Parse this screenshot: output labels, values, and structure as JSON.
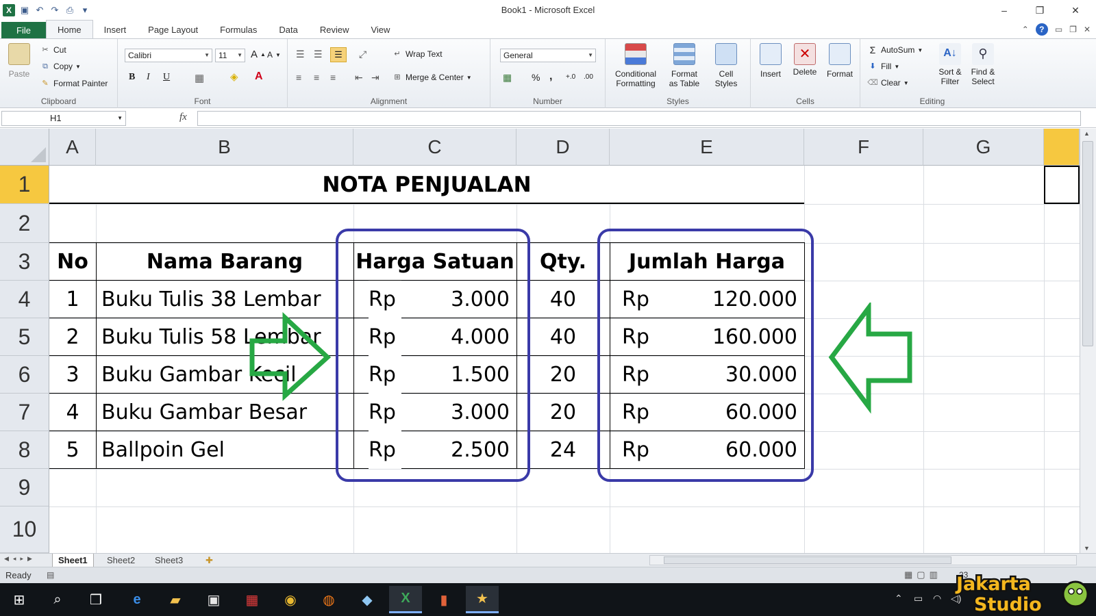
{
  "window": {
    "title": "Book1 - Microsoft Excel",
    "minimize": "–",
    "restore": "❐",
    "close": "✕"
  },
  "quick_access": {
    "app_icon": "X",
    "save": "▣",
    "undo": "↶",
    "redo": "↷",
    "preview": "⎙",
    "customize": "▾"
  },
  "tabs": [
    "File",
    "Home",
    "Insert",
    "Page Layout",
    "Formulas",
    "Data",
    "Review",
    "View"
  ],
  "ribbon": {
    "clipboard": {
      "label": "Clipboard",
      "paste": "Paste",
      "cut": "Cut",
      "copy": "Copy",
      "format_painter": "Format Painter"
    },
    "font": {
      "label": "Font",
      "name": "Calibri",
      "size": "11",
      "grow": "A",
      "shrink": "A",
      "bold": "B",
      "italic": "I",
      "underline": "U"
    },
    "alignment": {
      "label": "Alignment",
      "wrap_text": "Wrap Text",
      "merge_center": "Merge & Center"
    },
    "number": {
      "label": "Number",
      "format": "General",
      "percent": "%",
      "comma": ",",
      "inc_decimal": "+.0",
      "dec_decimal": ".00"
    },
    "styles": {
      "label": "Styles",
      "conditional_formatting_1": "Conditional",
      "conditional_formatting_2": "Formatting",
      "format_table_1": "Format",
      "format_table_2": "as Table",
      "cell_styles_1": "Cell",
      "cell_styles_2": "Styles"
    },
    "cells": {
      "label": "Cells",
      "insert": "Insert",
      "delete": "Delete",
      "format": "Format"
    },
    "editing": {
      "label": "Editing",
      "autosum": "AutoSum",
      "fill": "Fill",
      "clear": "Clear",
      "sort_filter_1": "Sort &",
      "sort_filter_2": "Filter",
      "find_select_1": "Find &",
      "find_select_2": "Select"
    }
  },
  "formula_bar": {
    "name_box": "H1",
    "fx": "fx",
    "value": ""
  },
  "columns": [
    "A",
    "B",
    "C",
    "D",
    "E",
    "F",
    "G"
  ],
  "rows": [
    "1",
    "2",
    "3",
    "4",
    "5",
    "6",
    "7",
    "8",
    "9",
    "10"
  ],
  "sheet": {
    "title": "NOTA PENJUALAN",
    "headers": {
      "no": "No",
      "nama": "Nama Barang",
      "harga": "Harga Satuan",
      "qty": "Qty.",
      "jumlah": "Jumlah Harga"
    },
    "currency": "Rp",
    "items": [
      {
        "no": "1",
        "nama": "Buku Tulis 38 Lembar",
        "harga": "3.000",
        "qty": "40",
        "jumlah": "120.000"
      },
      {
        "no": "2",
        "nama": "Buku Tulis 58 Lembar",
        "harga": "4.000",
        "qty": "40",
        "jumlah": "160.000"
      },
      {
        "no": "3",
        "nama": "Buku Gambar Kecil",
        "harga": "1.500",
        "qty": "20",
        "jumlah": "30.000"
      },
      {
        "no": "4",
        "nama": "Buku Gambar Besar",
        "harga": "3.000",
        "qty": "20",
        "jumlah": "60.000"
      },
      {
        "no": "5",
        "nama": "Ballpoin Gel",
        "harga": "2.500",
        "qty": "24",
        "jumlah": "60.000"
      }
    ]
  },
  "sheet_tabs": [
    "Sheet1",
    "Sheet2",
    "Sheet3"
  ],
  "status": {
    "ready": "Ready",
    "zoom": "23"
  },
  "watermark": {
    "line1": "Jakarta",
    "line2": "Studio"
  },
  "colors": {
    "excel_green": "#1f7244",
    "selection_yellow": "#f6c840",
    "highlight_box": "#3a3aa8",
    "arrow_green": "#27a844"
  }
}
